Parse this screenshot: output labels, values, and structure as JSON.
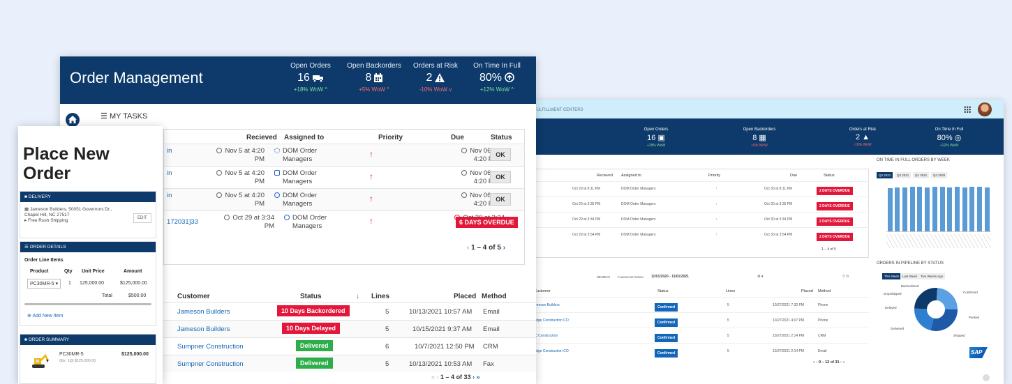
{
  "colors": {
    "navy": "#0d3a6b",
    "red": "#e2173a",
    "green": "#2eae4a",
    "link": "#1466b8",
    "positive": "#7fe39a",
    "negative": "#ff6a6a"
  },
  "main": {
    "title": "Order Management",
    "kpis": [
      {
        "label": "Open Orders",
        "value": "16",
        "icon": "truck-icon",
        "wow": "+18% WoW ^",
        "trend": "up"
      },
      {
        "label": "Open Backorders",
        "value": "8",
        "icon": "calendar-icon",
        "wow": "+5% WoW ^",
        "trend": "bad"
      },
      {
        "label": "Orders at Risk",
        "value": "2",
        "icon": "warning-icon",
        "wow": "-10% WoW v",
        "trend": "down"
      },
      {
        "label": "On Time In Full",
        "value": "80%",
        "icon": "clock-arrow-icon",
        "wow": "+12% WoW ^",
        "trend": "up"
      }
    ],
    "tasks": {
      "section_label": "MY TASKS",
      "headers": {
        "received": "Recieved",
        "assigned": "Assigned to",
        "priority": "Priority",
        "due": "Due",
        "status": "Status"
      },
      "rows": [
        {
          "id": "in",
          "received_1": "Nov 5 at 4:20",
          "received_2": "PM",
          "assigned_1": "DOM Order",
          "assigned_2": "Managers",
          "due_1": "Nov 06 at",
          "due_2": "4:20 PM",
          "status": "OK"
        },
        {
          "id": "in",
          "received_1": "Nov 5 at 4:20",
          "received_2": "PM",
          "assigned_1": "DOM Order",
          "assigned_2": "Managers",
          "due_1": "Nov 06 at",
          "due_2": "4:20 PM",
          "status": "OK"
        },
        {
          "id": "in",
          "received_1": "Nov 5 at 4:20",
          "received_2": "PM",
          "assigned_1": "DOM Order",
          "assigned_2": "Managers",
          "due_1": "Nov 06 at",
          "due_2": "4:20 PM",
          "status": "OK"
        },
        {
          "id": "172031]33",
          "received_1": "Oct 29 at 3:34",
          "received_2": "PM",
          "assigned_1": "DOM Order",
          "assigned_2": "Managers",
          "due_1": "Oct 30 at 3:34",
          "due_2": "PM",
          "status": "6 DAYS OVERDUE"
        }
      ],
      "pager": "1 – 4 of 5"
    },
    "orders": {
      "headers": {
        "customer": "Customer",
        "status": "Status",
        "lines": "Lines",
        "placed": "Placed",
        "method": "Method"
      },
      "rows": [
        {
          "customer": "Jameson Builders",
          "status": "10 Days Backordered",
          "lines": "5",
          "placed": "10/13/2021 10:57 AM",
          "method": "Email",
          "kind": "red"
        },
        {
          "customer": "Jameson Builders",
          "status": "10 Days Delayed",
          "lines": "5",
          "placed": "10/15/2021 9:37 AM",
          "method": "Email",
          "kind": "red"
        },
        {
          "customer": "Sumpner Construction",
          "status": "Delivered",
          "lines": "6",
          "placed": "10/7/2021 12:50 PM",
          "method": "CRM",
          "kind": "green"
        },
        {
          "customer": "Sumpner Construction",
          "status": "Delivered",
          "lines": "5",
          "placed": "10/13/2021 10:53 AM",
          "method": "Fax",
          "kind": "green"
        }
      ],
      "pager": "1 – 4 of 33"
    }
  },
  "place_order": {
    "title_1": "Place New",
    "title_2": "Order",
    "delivery": {
      "header": "DELIVERY",
      "address_1": "Jameson Builders, 50051 Governors Dr.,",
      "address_2": "Chapel Hill, NC 27517",
      "shipping": "Free Rush Shipping",
      "edit": "EDIT"
    },
    "details": {
      "header": "ORDER DETAILS",
      "line_items": "Order Line Items",
      "cols": {
        "product": "Product",
        "qty": "Qty",
        "unit_price": "Unit Price",
        "amount": "Amount"
      },
      "row": {
        "product": "PC30MR-5",
        "qty": "1",
        "unit_price": "125,000.00",
        "amount": "$125,000.00"
      },
      "total_label": "Total",
      "total_value": "$500.00",
      "add": "Add New Item"
    },
    "summary": {
      "header": "ORDER SUMMARY",
      "product": "PC30MR-5",
      "qty_line": "Qty: 1@ $125,000.00",
      "price": "$125,000.00"
    }
  },
  "back": {
    "breadcrumb": "FULFILLMENT CENTERS",
    "kpis": [
      {
        "label": "Open Orders",
        "value": "16",
        "wow": "+18% WoW"
      },
      {
        "label": "Open Backorders",
        "value": "8",
        "wow": "+5% WoW"
      },
      {
        "label": "Orders at Risk",
        "value": "2",
        "wow": "-10% WoW"
      },
      {
        "label": "On Time In Full",
        "value": "80%",
        "wow": "+12% WoW"
      }
    ],
    "tasks_headers": {
      "received": "Recieved",
      "assigned": "Assigned to",
      "priority": "Priority",
      "due": "Due",
      "status": "Status"
    },
    "tasks": [
      {
        "received": "Oct 29 at 8:11 PM",
        "assigned": "DOM Order Managers",
        "due": "Oct 30 at 8:11 PM",
        "status": "2 DAYS OVERDUE"
      },
      {
        "received": "Oct 29 at 3:35 PM",
        "assigned": "DOM Order Managers",
        "due": "Oct 30 at 3:35 PM",
        "status": "2 DAYS OVERDUE"
      },
      {
        "received": "Oct 29 at 3:34 PM",
        "assigned": "DOM Order Managers",
        "due": "Oct 30 at 3:34 PM",
        "status": "2 DAYS OVERDUE"
      },
      {
        "received": "Oct 29 at 3:54 PM",
        "assigned": "DOM Order Managers",
        "due": "Oct 30 at 3:54 PM",
        "status": "2 DAYS OVERDUE"
      }
    ],
    "tasks_pager": "1 – 4 of 5",
    "chart_title": "ON TIME IN FULL ORDERS BY WEEK",
    "chart_tabs": [
      "Q4 2021",
      "Q3 2021",
      "Q1 2021",
      "Q4 2020"
    ],
    "chart_bars": [
      88,
      90,
      90,
      92,
      91,
      90,
      91,
      92,
      90,
      91,
      90,
      92,
      91,
      90
    ],
    "pipe_title": "ORDERS IN PIPELINE BY STATUS",
    "pipe_tabs": [
      "This Week",
      "Last Week",
      "Two Weeks Ago"
    ],
    "pipe_labels": {
      "backordered": "Backordered",
      "dropshipped": "Dropshipped",
      "confirmed": "Confirmed",
      "delayed": "Delayed",
      "packed": "Packed",
      "delivered": "Delivered",
      "shipped": "Shipped"
    },
    "filter": {
      "search": "SEARCH",
      "placed_between": "PLACED BETWEEN",
      "range": "11/01/2020 - 11/01/2021"
    },
    "order_headers": {
      "customer": "Customer",
      "status": "Status",
      "lines": "Lines",
      "placed": "Placed",
      "method": "Method"
    },
    "orders": [
      {
        "customer": "Jameson Builders",
        "status": "Confirmed",
        "lines": "5",
        "placed": "10/27/2021 7:32 PM",
        "method": "Phone"
      },
      {
        "customer": "Bridge Construction CO",
        "status": "Confirmed",
        "lines": "5",
        "placed": "10/27/2021 4:07 PM",
        "method": "Phone"
      },
      {
        "customer": "MC Construction",
        "status": "Confirmed",
        "lines": "5",
        "placed": "10/27/2021 2:14 PM",
        "method": "CRM"
      },
      {
        "customer": "Bridge Construction CO",
        "status": "Confirmed",
        "lines": "5",
        "placed": "10/27/2021 2:14 PM",
        "method": "Email"
      }
    ],
    "orders_pager": "9 – 12 of 31",
    "logo": "SAP"
  }
}
